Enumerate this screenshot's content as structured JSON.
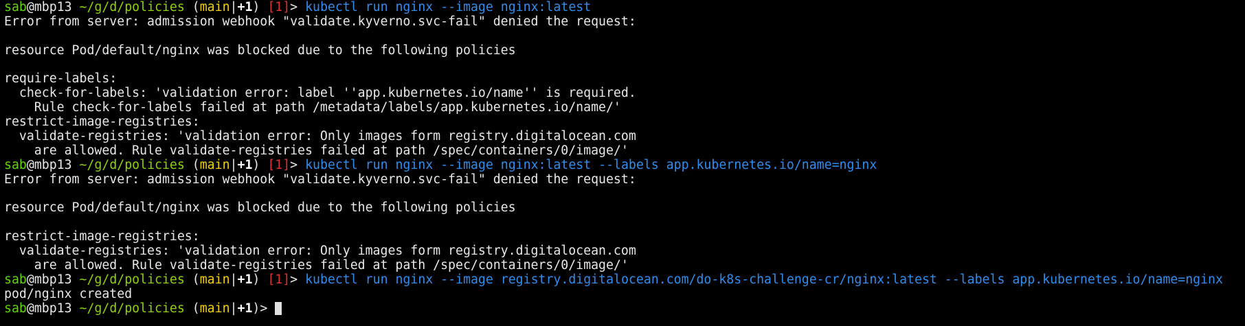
{
  "prompt": {
    "user": "sab",
    "at": "@",
    "host": "mbp13",
    "cwd": "~/g/d/policies",
    "paren_open": "(",
    "branch": "main",
    "separator": "|",
    "changes": "+1",
    "paren_close": ")",
    "exit_code": "[1]",
    "arrow": ">"
  },
  "colors": {
    "background": "#000000",
    "text": "#e8e8e8",
    "user": "#5fd700",
    "cwd": "#8fd400",
    "branch": "#f0d000",
    "exit_code": "#e03030",
    "command": "#2d8ef0"
  },
  "lines": [
    {
      "type": "prompt",
      "exit": true,
      "command": "kubectl run nginx --image nginx:latest"
    },
    {
      "type": "output",
      "text": "Error from server: admission webhook \"validate.kyverno.svc-fail\" denied the request:"
    },
    {
      "type": "output",
      "text": ""
    },
    {
      "type": "output",
      "text": "resource Pod/default/nginx was blocked due to the following policies"
    },
    {
      "type": "output",
      "text": ""
    },
    {
      "type": "output",
      "text": "require-labels:"
    },
    {
      "type": "output",
      "text": "  check-for-labels: 'validation error: label ''app.kubernetes.io/name'' is required."
    },
    {
      "type": "output",
      "text": "    Rule check-for-labels failed at path /metadata/labels/app.kubernetes.io/name/'"
    },
    {
      "type": "output",
      "text": "restrict-image-registries:"
    },
    {
      "type": "output",
      "text": "  validate-registries: 'validation error: Only images form registry.digitalocean.com"
    },
    {
      "type": "output",
      "text": "    are allowed. Rule validate-registries failed at path /spec/containers/0/image/'"
    },
    {
      "type": "prompt",
      "exit": true,
      "command": "kubectl run nginx --image nginx:latest --labels app.kubernetes.io/name=nginx"
    },
    {
      "type": "output",
      "text": "Error from server: admission webhook \"validate.kyverno.svc-fail\" denied the request:"
    },
    {
      "type": "output",
      "text": ""
    },
    {
      "type": "output",
      "text": "resource Pod/default/nginx was blocked due to the following policies"
    },
    {
      "type": "output",
      "text": ""
    },
    {
      "type": "output",
      "text": "restrict-image-registries:"
    },
    {
      "type": "output",
      "text": "  validate-registries: 'validation error: Only images form registry.digitalocean.com"
    },
    {
      "type": "output",
      "text": "    are allowed. Rule validate-registries failed at path /spec/containers/0/image/'"
    },
    {
      "type": "prompt",
      "exit": true,
      "command": "kubectl run nginx --image registry.digitalocean.com/do-k8s-challenge-cr/nginx:latest --labels app.kubernetes.io/name=nginx"
    },
    {
      "type": "output",
      "text": "pod/nginx created"
    },
    {
      "type": "prompt",
      "exit": false,
      "command": "",
      "cursor": true
    }
  ]
}
